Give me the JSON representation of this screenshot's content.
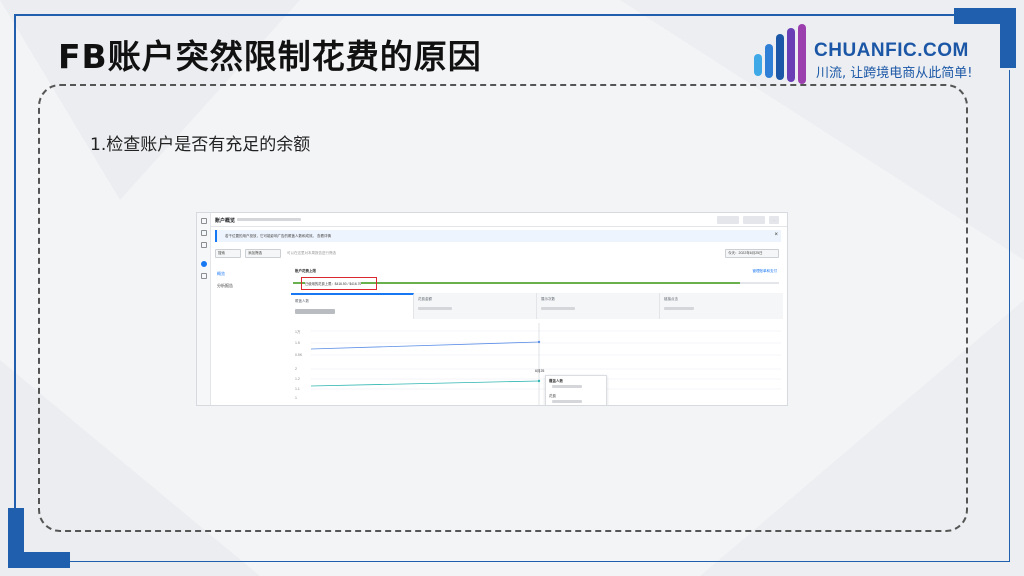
{
  "slide": {
    "title": "FB账户突然限制花费的原因",
    "point": "1.检查账户是否有充足的余额"
  },
  "logo": {
    "brand": "CHUANFIC.COM",
    "slogan": "川流, 让跨境电商从此简单!",
    "icon": "bar-logo-icon",
    "color": "#1b57a6"
  },
  "screenshot": {
    "header_title": "账户概览",
    "notice_text": "若干位置的用户投放，它可能影响广告的覆盖人数和成效。 查看详情",
    "notice_close": "×",
    "filter_label": "搜索",
    "filter2_label": "添加筛选",
    "search_placeholder": "可以在这里对本周报告进行筛选",
    "date_range": "今天：2022年6月25日",
    "subnav": [
      "概览",
      "分析报告"
    ],
    "budget_label": "账户花费上限",
    "budget_link": "管理账单和支付",
    "budget_text": "已使用的花费上限：$416.50 / $416.70",
    "metric_tabs": [
      "覆盖人数",
      "花费金额",
      "展示次数",
      "链接点击"
    ],
    "y_ticks_top": [
      "1万",
      "1.5",
      "0.5K"
    ],
    "y_ticks_bottom": [
      "2",
      "1.2",
      "1.1",
      "1"
    ],
    "tooltip_date": "6月25",
    "tooltip_title": "覆盖人数",
    "tooltip_sub": "花费",
    "colors": {
      "accent": "#1877f2",
      "highlight": "#d9282f",
      "green": "#6ab04c",
      "teal": "#2fb5b1"
    }
  }
}
